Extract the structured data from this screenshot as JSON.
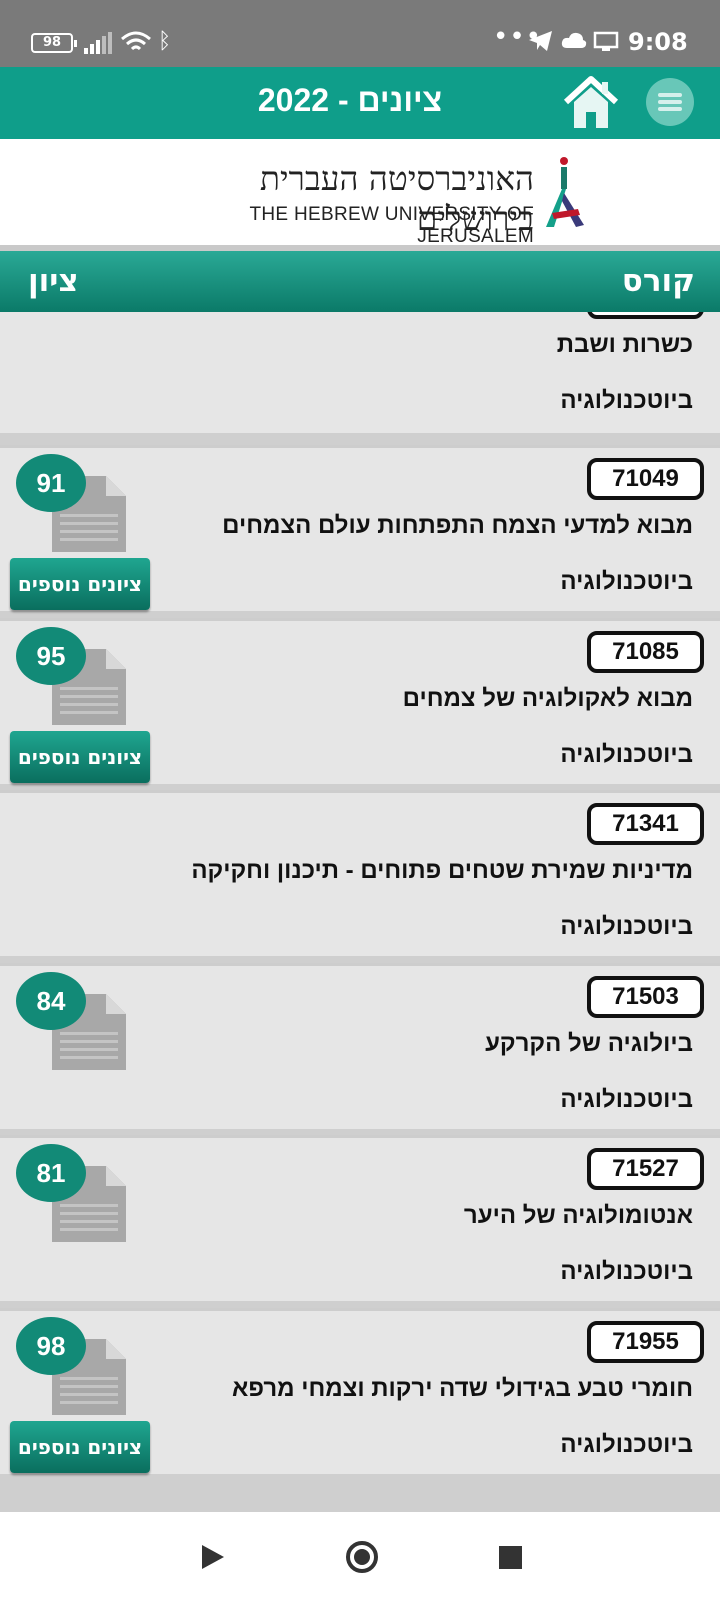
{
  "status_bar": {
    "battery": "98",
    "time": "9:08",
    "icons": [
      "battery-icon",
      "signal-icon",
      "wifi-icon",
      "bluetooth-icon",
      "more-dots-icon",
      "telegram-icon",
      "cloud-icon",
      "cast-icon"
    ]
  },
  "app_bar": {
    "title": "ציונים - 2022",
    "icons": [
      "home-icon",
      "menu-icon"
    ]
  },
  "logo": {
    "hebrew": "האוניברסיטה העברית בירושלים",
    "english": "THE HEBREW UNIVERSITY OF JERUSALEM"
  },
  "table_header": {
    "course": "קורס",
    "grade": "ציון"
  },
  "courses": [
    {
      "code": "",
      "name": "כשרות ושבת",
      "faculty": "ביוטכנולוגיה",
      "grade": "",
      "more": ""
    },
    {
      "code": "71049",
      "name": "מבוא למדעי הצמח  התפתחות עולם הצמחים",
      "faculty": "ביוטכנולוגיה",
      "grade": "91",
      "more": "ציונים נוספים"
    },
    {
      "code": "71085",
      "name": "מבוא לאקולוגיה של צמחים",
      "faculty": "ביוטכנולוגיה",
      "grade": "95",
      "more": "ציונים נוספים"
    },
    {
      "code": "71341",
      "name": "מדיניות שמירת שטחים פתוחים - תיכנון וחקיקה",
      "faculty": "ביוטכנולוגיה",
      "grade": "",
      "more": ""
    },
    {
      "code": "71503",
      "name": "ביולוגיה של הקרקע",
      "faculty": "ביוטכנולוגיה",
      "grade": "84",
      "more": ""
    },
    {
      "code": "71527",
      "name": "אנטומולוגיה של היער",
      "faculty": "ביוטכנולוגיה",
      "grade": "81",
      "more": ""
    },
    {
      "code": "71955",
      "name": "חומרי טבע בגידולי שדה ירקות וצמחי מרפא",
      "faculty": "ביוטכנולוגיה",
      "grade": "98",
      "more": "ציונים נוספים"
    }
  ],
  "nav_bar": {
    "icons": [
      "back-icon",
      "home-circle-icon",
      "recents-icon"
    ]
  },
  "colors": {
    "teal": "#0f9e8a",
    "teal_dark": "#0b7a68",
    "row_bg": "#e6e6e6",
    "status_bar": "#7a7a7a"
  }
}
